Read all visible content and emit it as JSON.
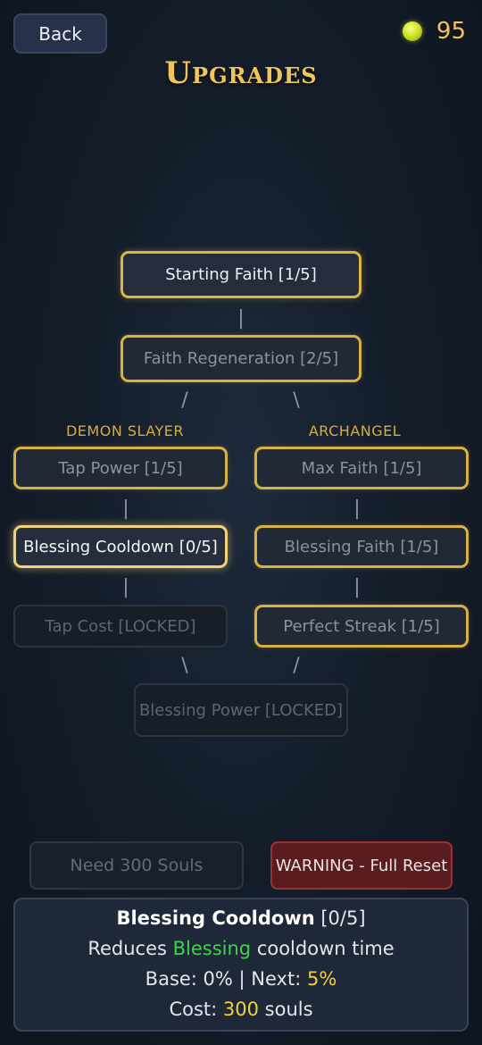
{
  "header": {
    "back_label": "Back",
    "souls_count": "95",
    "title": "Upgrades"
  },
  "tree": {
    "connectors": {
      "vertical": "|",
      "left": "/",
      "right": "\\"
    },
    "branches": {
      "left": "DEMON SLAYER",
      "right": "ARCHANGEL"
    },
    "nodes": {
      "starting_faith": "Starting Faith [1/5]",
      "faith_regeneration": "Faith Regeneration [2/5]",
      "tap_power": "Tap Power [1/5]",
      "max_faith": "Max Faith [1/5]",
      "blessing_cooldown": "Blessing Cooldown [0/5]",
      "blessing_faith": "Blessing Faith [1/5]",
      "tap_cost": "Tap Cost [LOCKED]",
      "perfect_streak": "Perfect Streak [1/5]",
      "blessing_power": "Blessing Power [LOCKED]"
    }
  },
  "actions": {
    "need_souls_label": "Need 300 Souls",
    "reset_label": "WARNING - Full Reset"
  },
  "info": {
    "name": "Blessing Cooldown",
    "level": " [0/5]",
    "desc_prefix": "Reduces ",
    "desc_highlight": "Blessing",
    "desc_suffix": " cooldown time",
    "base_label": "Base: 0% | Next: ",
    "next_value": "5%",
    "cost_label": "Cost: ",
    "cost_value": "300",
    "cost_suffix": " souls"
  },
  "colors": {
    "gold": "#dcb542",
    "title": "#f0c55c",
    "green_highlight": "#3fd34a",
    "yellow_highlight": "#f0d23c",
    "warning_red": "#5a1d1f"
  }
}
